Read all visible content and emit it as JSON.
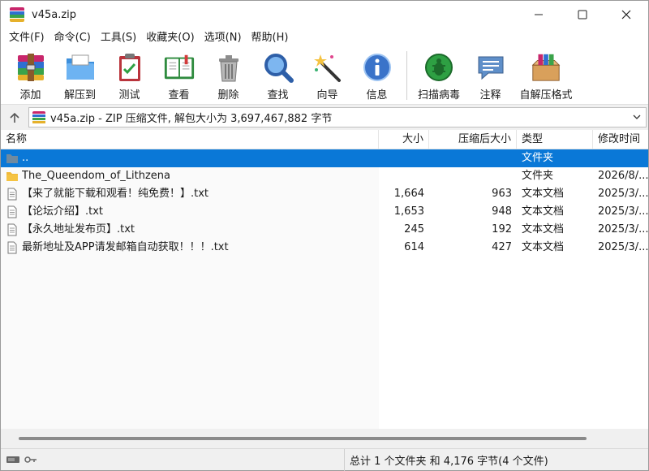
{
  "window": {
    "title": "v45a.zip",
    "controls": {
      "minimize": "—",
      "maximize": "☐",
      "close": "✕"
    }
  },
  "menu": [
    {
      "label": "文件(F)"
    },
    {
      "label": "命令(C)"
    },
    {
      "label": "工具(S)"
    },
    {
      "label": "收藏夹(O)"
    },
    {
      "label": "选项(N)"
    },
    {
      "label": "帮助(H)"
    }
  ],
  "toolbar": [
    {
      "label": "添加",
      "icon": "add-archive-icon"
    },
    {
      "label": "解压到",
      "icon": "extract-folder-icon"
    },
    {
      "label": "测试",
      "icon": "test-clipboard-icon"
    },
    {
      "label": "查看",
      "icon": "view-book-icon"
    },
    {
      "label": "删除",
      "icon": "trash-icon"
    },
    {
      "label": "查找",
      "icon": "magnifier-icon"
    },
    {
      "label": "向导",
      "icon": "wizard-wand-icon"
    },
    {
      "label": "信息",
      "icon": "info-icon"
    },
    {
      "label": "扫描病毒",
      "icon": "virus-scan-icon"
    },
    {
      "label": "注释",
      "icon": "comment-icon"
    },
    {
      "label": "自解压格式",
      "icon": "sfx-box-icon"
    }
  ],
  "address": {
    "up_label": "↑",
    "path": "v45a.zip - ZIP 压缩文件, 解包大小为 3,697,467,882 字节",
    "dropdown": "⌄"
  },
  "columns": {
    "name": "名称",
    "size": "大小",
    "packed": "压缩后大小",
    "type": "类型",
    "modified": "修改时间",
    "sort_caret": "^"
  },
  "rows": [
    {
      "name": "..",
      "size": "",
      "packed": "",
      "type": "文件夹",
      "modified": "",
      "icon": "folder-up-icon",
      "selected": true
    },
    {
      "name": "The_Queendom_of_Lithzena",
      "size": "",
      "packed": "",
      "type": "文件夹",
      "modified": "2026/8/...",
      "icon": "folder-icon",
      "selected": false
    },
    {
      "name": "【来了就能下载和观看！纯免费！】.txt",
      "size": "1,664",
      "packed": "963",
      "type": "文本文档",
      "modified": "2025/3/...",
      "icon": "text-file-icon",
      "selected": false
    },
    {
      "name": "【论坛介绍】.txt",
      "size": "1,653",
      "packed": "948",
      "type": "文本文档",
      "modified": "2025/3/...",
      "icon": "text-file-icon",
      "selected": false
    },
    {
      "name": "【永久地址发布页】.txt",
      "size": "245",
      "packed": "192",
      "type": "文本文档",
      "modified": "2025/3/...",
      "icon": "text-file-icon",
      "selected": false
    },
    {
      "name": "最新地址及APP请发邮箱自动获取！！！.txt",
      "size": "614",
      "packed": "427",
      "type": "文本文档",
      "modified": "2025/3/...",
      "icon": "text-file-icon",
      "selected": false
    }
  ],
  "status": {
    "text": "总计 1 个文件夹 和 4,176 字节(4 个文件)"
  },
  "colors": {
    "selection": "#0a78d7",
    "folder": "#f5c342"
  }
}
